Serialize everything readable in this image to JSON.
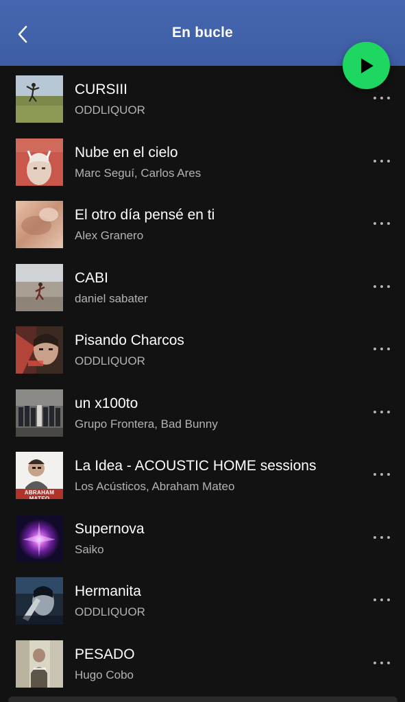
{
  "header": {
    "title": "En bucle"
  },
  "tracks": [
    {
      "title": "CURSIII",
      "artist": "ODDLIQUOR"
    },
    {
      "title": "Nube en el cielo",
      "artist": "Marc Seguí, Carlos Ares"
    },
    {
      "title": "El otro día pensé en ti",
      "artist": "Alex Granero"
    },
    {
      "title": "CABI",
      "artist": "daniel sabater"
    },
    {
      "title": "Pisando Charcos",
      "artist": "ODDLIQUOR"
    },
    {
      "title": "un x100to",
      "artist": "Grupo Frontera, Bad Bunny"
    },
    {
      "title": "La Idea - ACOUSTIC HOME sessions",
      "artist": "Los Acústicos, Abraham Mateo",
      "cover_text": "ABRAHAM MATEO"
    },
    {
      "title": "Supernova",
      "artist": "Saiko"
    },
    {
      "title": "Hermanita",
      "artist": "ODDLIQUOR"
    },
    {
      "title": "PESADO",
      "artist": "Hugo Cobo"
    }
  ],
  "colors": {
    "header_bg": "#4667b0",
    "background": "#121212",
    "accent": "#1ed760",
    "secondary_text": "#b3b3b3"
  },
  "icons": {
    "back": "chevron-left-icon",
    "play": "play-icon",
    "more": "more-horizontal-icon"
  }
}
